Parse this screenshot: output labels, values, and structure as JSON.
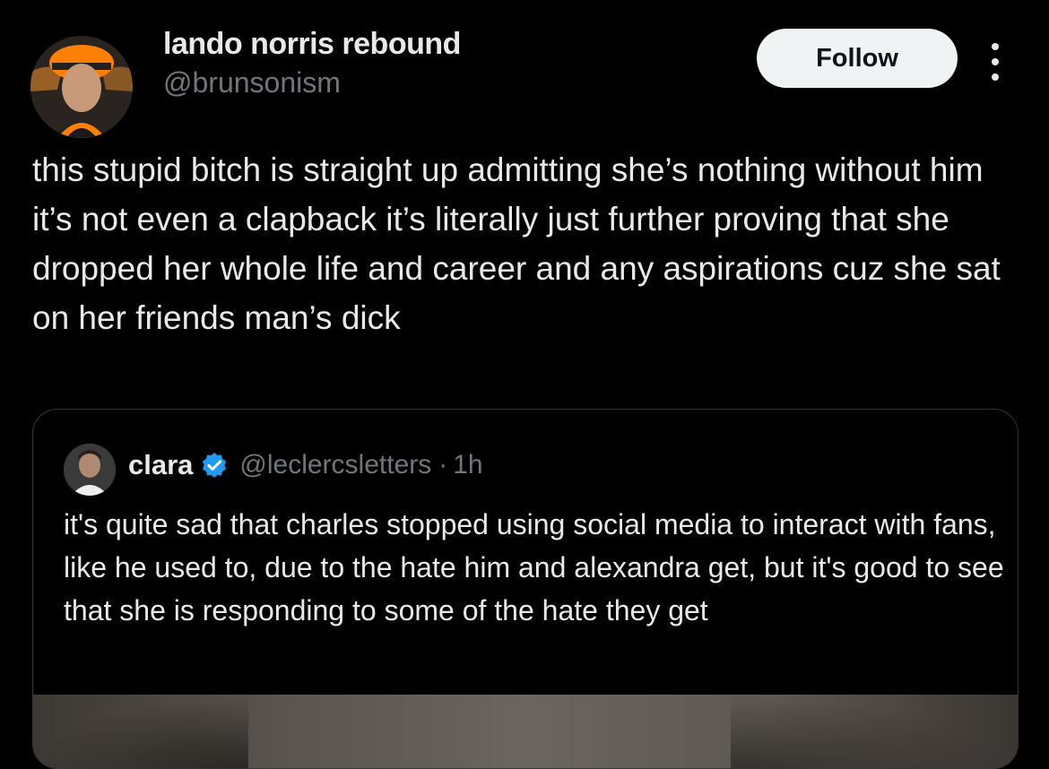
{
  "author": {
    "display_name": "lando norris rebound",
    "handle": "@brunsonism",
    "avatar": "avatar-icon"
  },
  "actions": {
    "follow_label": "Follow",
    "more_icon": "more-vertical-icon"
  },
  "tweet": {
    "text": "this stupid bitch is straight up admitting she’s nothing without him it’s not even a clapback it’s literally just further proving that she dropped her whole life and career and any aspirations cuz she sat on her friends man’s dick"
  },
  "quote": {
    "name": "clara",
    "handle": "@leclercsletters",
    "separator": "·",
    "time": "1h",
    "text": "it's quite sad that charles stopped using social media to interact with fans, like he used to, due to the hate him and alexandra get, but it's good to see that she is responding to some of the hate they get",
    "verified_icon": "verified-badge-icon"
  },
  "colors": {
    "background": "#000000",
    "text": "#e7e9ea",
    "secondary_text": "#71767b",
    "follow_bg": "#eff3f4",
    "verified": "#1d9bf0",
    "border": "#333639"
  }
}
